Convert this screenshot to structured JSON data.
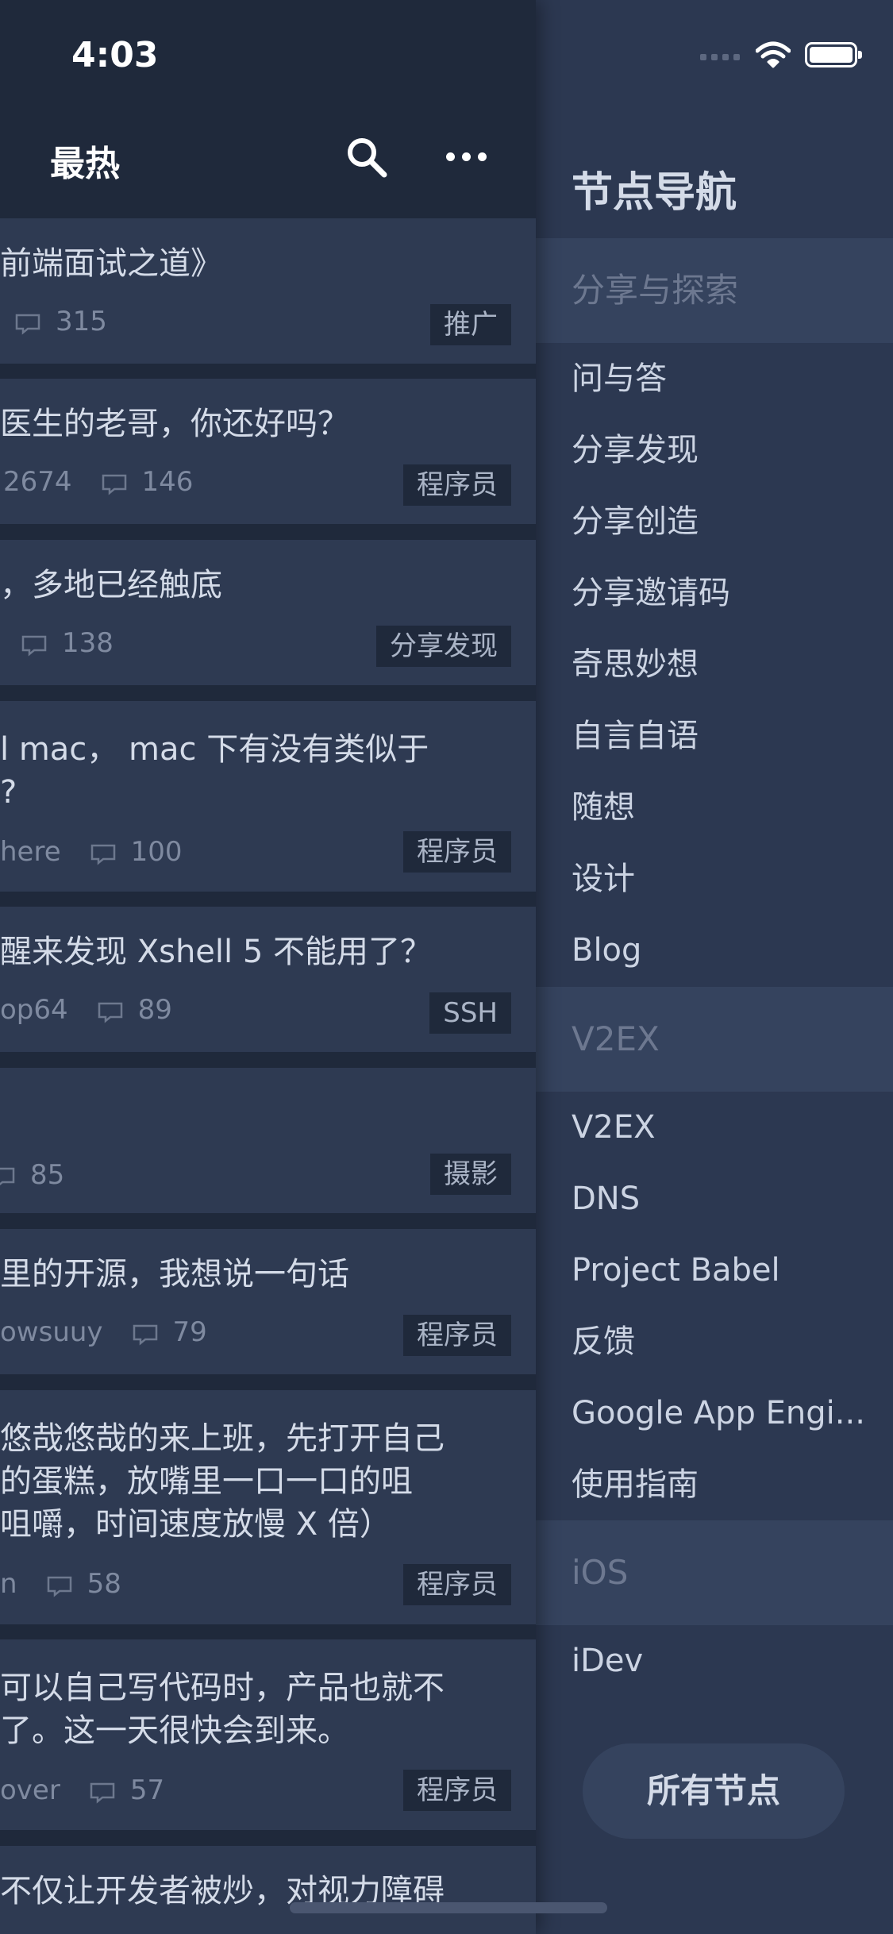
{
  "status_bar": {
    "time": "4:03"
  },
  "main": {
    "nav_title": "最热",
    "topics": [
      {
        "title_lines": [
          "前端面试之道》"
        ],
        "author": "",
        "comments": "315",
        "tag": "推广"
      },
      {
        "title_lines": [
          "医生的老哥，你还好吗？"
        ],
        "author": "2674",
        "comments": "146",
        "tag": "程序员"
      },
      {
        "title_lines": [
          "，多地已经触底"
        ],
        "author": "",
        "comments": "138",
        "tag": "分享发现"
      },
      {
        "title_lines": [
          "l mac， mac 下有没有类似于",
          "?"
        ],
        "author": "here",
        "comments": "100",
        "tag": "程序员"
      },
      {
        "title_lines": [
          "醒来发现 Xshell 5 不能用了？"
        ],
        "author": "op64",
        "comments": "89",
        "tag": "SSH"
      },
      {
        "title_lines": [
          ""
        ],
        "author": "",
        "comments": "85",
        "tag": "摄影"
      },
      {
        "title_lines": [
          "里的开源，我想说一句话"
        ],
        "author": "owsuuy",
        "comments": "79",
        "tag": "程序员"
      },
      {
        "title_lines": [
          "悠哉悠哉的来上班，先打开自己",
          "的蛋糕，放嘴里一口一口的咀",
          "咀嚼，时间速度放慢 X 倍）"
        ],
        "author": "n",
        "comments": "58",
        "tag": "程序员"
      },
      {
        "title_lines": [
          "可以自己写代码时，产品也就不",
          "了。这一天很快会到来。"
        ],
        "author": "over",
        "comments": "57",
        "tag": "程序员"
      },
      {
        "title_lines": [
          "不仅让开发者被炒，对视力障碍"
        ],
        "author": "",
        "comments": "",
        "tag": ""
      }
    ]
  },
  "drawer": {
    "title": "节点导航",
    "sections": [
      {
        "header": "分享与探索",
        "items": [
          "问与答",
          "分享发现",
          "分享创造",
          "分享邀请码",
          "奇思妙想",
          "自言自语",
          "随想",
          "设计",
          "Blog"
        ]
      },
      {
        "header": "V2EX",
        "items": [
          "V2EX",
          "DNS",
          "Project Babel",
          "反馈",
          "Google App Engi...",
          "使用指南"
        ]
      },
      {
        "header": "iOS",
        "items": [
          "iDev"
        ]
      }
    ],
    "all_nodes_label": "所有节点"
  },
  "colors": {
    "drawer_bg": "#2c3851",
    "section_bg": "#35435e",
    "card_bg": "#2e3a52",
    "list_bg": "#1f293b",
    "text": "#d4dbe8",
    "muted": "#7f8aa0"
  }
}
